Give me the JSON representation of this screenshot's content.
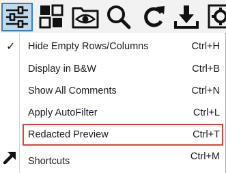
{
  "toolbar": {
    "buttons": [
      {
        "icon": "sliders-icon",
        "active": true
      },
      {
        "icon": "grid-squares-icon",
        "active": false
      },
      {
        "icon": "folder-eye-icon",
        "active": false
      },
      {
        "icon": "magnifier-icon",
        "active": false
      },
      {
        "icon": "refresh-icon",
        "active": false
      },
      {
        "icon": "download-icon",
        "active": false
      },
      {
        "icon": "settings-icon",
        "active": false
      }
    ]
  },
  "menu": {
    "items": [
      {
        "label": "Hide Empty Rows/Columns",
        "shortcut": "Ctrl+H",
        "checked": true
      },
      {
        "label": "Display in B&W",
        "shortcut": "Ctrl+B",
        "checked": false
      },
      {
        "label": "Show All Comments",
        "shortcut": "Ctrl+N",
        "checked": false
      },
      {
        "label": "Apply AutoFilter",
        "shortcut": "Ctrl+L",
        "checked": false
      },
      {
        "label": "Redacted Preview",
        "shortcut": "Ctrl+T",
        "checked": false,
        "highlighted": true
      },
      {
        "label": "Shortcuts",
        "shortcut": "Ctrl+M",
        "checked": false,
        "icon": "arrow-up-right-icon"
      }
    ],
    "check_glyph": "✓"
  },
  "colors": {
    "active_fill": "#bcd9ee",
    "active_border": "#3c7fb3",
    "highlight_border": "#d9453b",
    "icon": "#111111"
  }
}
